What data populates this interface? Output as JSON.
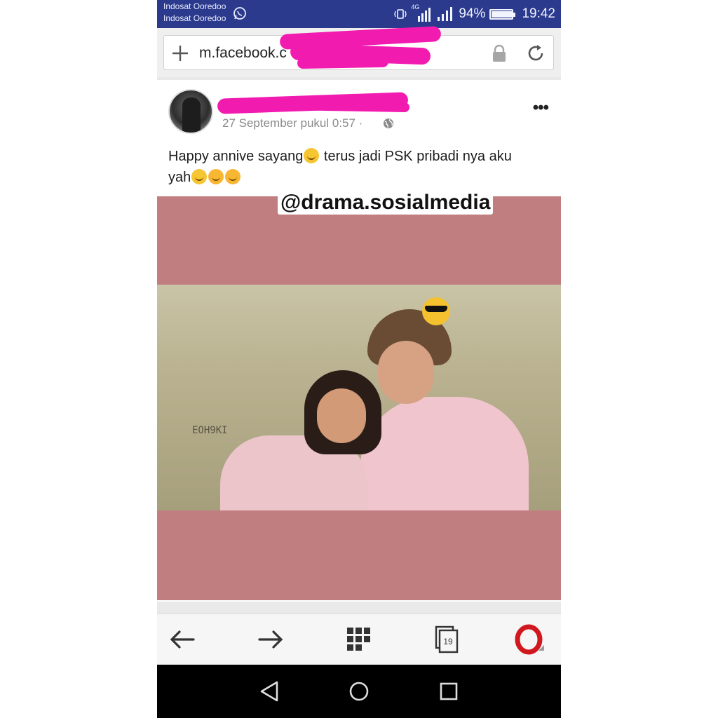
{
  "status_bar": {
    "carrier_1": "Indosat Ooredoo",
    "carrier_2": "Indosat Ooredoo",
    "network_type": "4G",
    "battery_level": "94%",
    "battery_fraction": 0.94,
    "time": "19:42"
  },
  "address_bar": {
    "url": "m.facebook.c",
    "redacted": true
  },
  "post": {
    "author_redacted": true,
    "time": "27 September pukul 0:57 ·",
    "text_line_1": "Happy annive sayang",
    "text_line_1b": " terus jadi PSK pribadi nya aku",
    "text_line_2": "yah",
    "more_label": "•••"
  },
  "photo": {
    "watermark": "@drama.sosialmedia",
    "wall_text": "EOH9KI"
  },
  "browser_toolbar": {
    "tab_count": "19"
  },
  "colors": {
    "status_bar": "#2b3a8c",
    "redaction": "#f21bb0",
    "photo_background": "#c17e80",
    "opera_red": "#d0181e"
  },
  "icons": [
    "whatsapp-icon",
    "signal-icon",
    "battery-icon",
    "new-tab-icon",
    "lock-icon",
    "reload-icon",
    "globe-icon",
    "more-options-icon",
    "back-arrow-icon",
    "forward-arrow-icon",
    "speed-dial-icon",
    "tabs-icon",
    "opera-logo-icon",
    "nav-back-icon",
    "nav-home-icon",
    "nav-recents-icon"
  ]
}
